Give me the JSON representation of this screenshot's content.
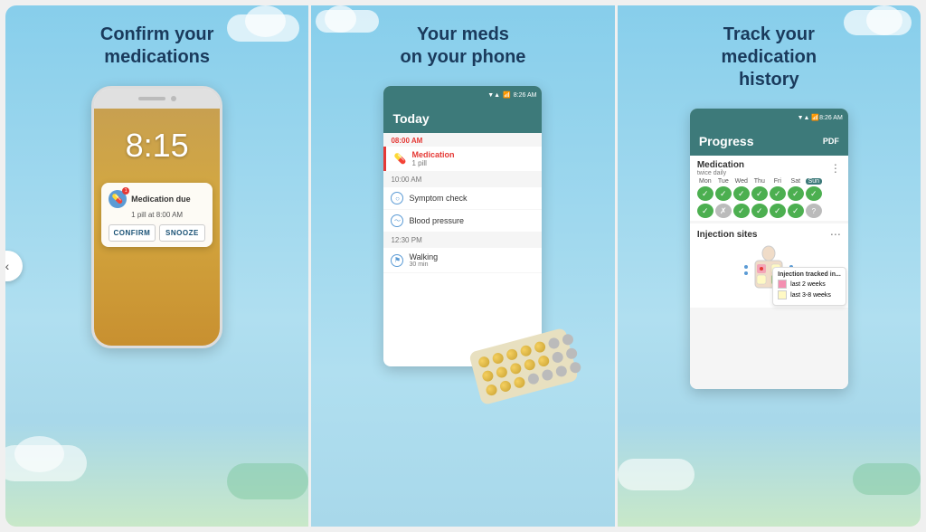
{
  "panel1": {
    "title": "Confirm your\nmedications",
    "phone": {
      "time": "8:15",
      "notification": {
        "title": "Medication due",
        "subtitle": "1 pill at 8:00 AM",
        "confirm_btn": "CONFIRM",
        "snooze_btn": "SNOOZE"
      }
    },
    "nav_arrow": "‹"
  },
  "panel2": {
    "title": "Your meds\non your phone",
    "app": {
      "status_time": "8:26 AM",
      "header_title": "Today",
      "sections": [
        {
          "time": "08:00 AM",
          "items": [
            {
              "name": "Medication",
              "dose": "1 pill",
              "urgent": true
            }
          ]
        },
        {
          "time": "10:00 AM",
          "items": [
            {
              "name": "Symptom check",
              "urgent": false
            },
            {
              "name": "Blood pressure",
              "urgent": false
            }
          ]
        },
        {
          "time": "12:30 PM",
          "items": [
            {
              "name": "Walking",
              "dose": "30 min",
              "urgent": false
            }
          ]
        }
      ]
    }
  },
  "panel3": {
    "title": "Track your\nmedication\nhistory",
    "app": {
      "status_time": "8:26 AM",
      "header_title": "Progress",
      "pdf_label": "PDF",
      "medication_section": {
        "title": "Medication",
        "subtitle": "twice daily",
        "days": [
          "Mon",
          "Tue",
          "Wed",
          "Thu",
          "Fri",
          "Sat",
          "Sun"
        ],
        "row1": [
          "✓",
          "✓",
          "✓",
          "✓",
          "✓",
          "✓",
          "✓"
        ],
        "row2": [
          "✓",
          "✗",
          "✓",
          "✓",
          "✓",
          "✓",
          "?"
        ]
      },
      "injection_section": {
        "title": "Injection sites",
        "legend_title": "Injection tracked in...",
        "legend": [
          {
            "color": "#f48fb1",
            "label": "last 2 weeks"
          },
          {
            "color": "#fff9c4",
            "label": "last 3-8 weeks"
          }
        ]
      }
    }
  }
}
